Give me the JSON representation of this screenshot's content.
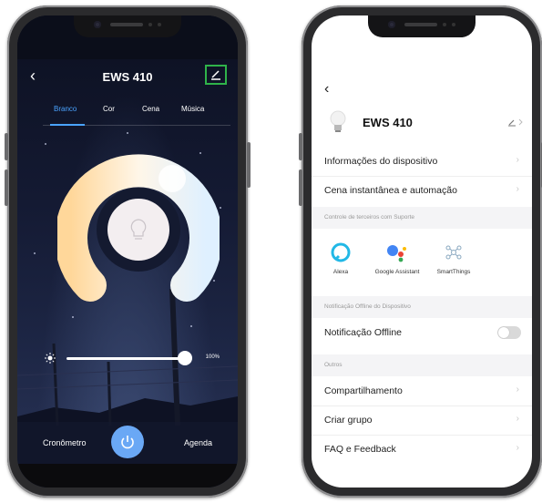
{
  "left_screen": {
    "title": "EWS 410",
    "tabs": [
      "Branco",
      "Cor",
      "Cena",
      "Música"
    ],
    "active_tab": "Branco",
    "brightness_value": "100%",
    "brightness_fraction": 1.0,
    "bottom": {
      "timer_label": "Cronômetro",
      "schedule_label": "Agenda"
    },
    "colors": {
      "accent": "#4aa3ff",
      "power_button": "#6aa8f5",
      "highlight_border": "#2fb34a"
    }
  },
  "right_screen": {
    "title": "EWS 410",
    "menu_primary": [
      {
        "label": "Informações do dispositivo"
      },
      {
        "label": "Cena instantânea e automação"
      }
    ],
    "third_party_section": "Controle de terceiros com Suporte",
    "integrations": [
      {
        "label": "Alexa",
        "icon": "alexa-icon"
      },
      {
        "label": "Google Assistant",
        "icon": "google-assistant-icon"
      },
      {
        "label": "SmartThings",
        "icon": "smartthings-icon"
      }
    ],
    "offline_section": "Notificação Offline do Dispositivo",
    "offline_notification": {
      "label": "Notificação Offline",
      "enabled": false
    },
    "others_section": "Outros",
    "menu_others": [
      {
        "label": "Compartilhamento"
      },
      {
        "label": "Criar grupo"
      },
      {
        "label": "FAQ e Feedback"
      }
    ]
  }
}
